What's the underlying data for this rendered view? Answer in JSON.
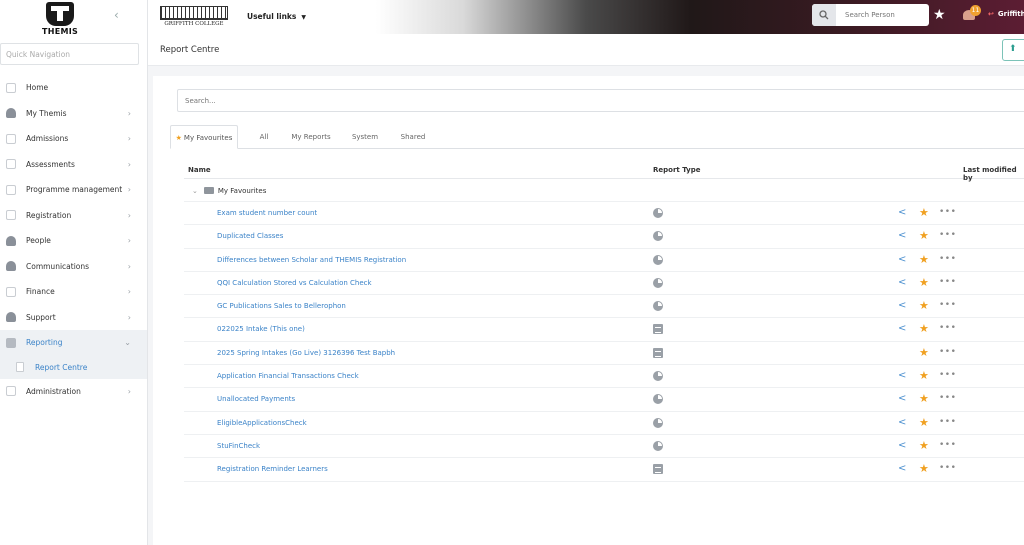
{
  "sidebar": {
    "logo_text": "THEMIS",
    "quick_nav_placeholder": "Quick Navigation",
    "items": [
      {
        "label": "Home",
        "has_chevron": false
      },
      {
        "label": "My Themis",
        "has_chevron": true
      },
      {
        "label": "Admissions",
        "has_chevron": true
      },
      {
        "label": "Assessments",
        "has_chevron": true
      },
      {
        "label": "Programme management",
        "has_chevron": true
      },
      {
        "label": "Registration",
        "has_chevron": true
      },
      {
        "label": "People",
        "has_chevron": true
      },
      {
        "label": "Communications",
        "has_chevron": true
      },
      {
        "label": "Finance",
        "has_chevron": true
      },
      {
        "label": "Support",
        "has_chevron": true
      },
      {
        "label": "Reporting",
        "has_chevron": true,
        "expanded": true
      },
      {
        "label": "Administration",
        "has_chevron": true
      }
    ],
    "reporting_sub": {
      "label": "Report Centre"
    }
  },
  "header": {
    "college_name": "GRIFFITH COLLEGE",
    "useful_links": "Useful links",
    "search_person_placeholder": "Search Person",
    "notification_count": "11",
    "user_name": "Griffith"
  },
  "page": {
    "title": "Report Centre"
  },
  "search": {
    "placeholder": "Search..."
  },
  "tabs": [
    {
      "label": "My Favourites",
      "active": true
    },
    {
      "label": "All"
    },
    {
      "label": "My Reports"
    },
    {
      "label": "System"
    },
    {
      "label": "Shared"
    }
  ],
  "table": {
    "columns": {
      "name": "Name",
      "report_type": "Report Type",
      "last_modified": "Last modified by"
    },
    "folder_label": "My Favourites",
    "rows": [
      {
        "name": "Exam student number count",
        "type": "chart",
        "shared": true
      },
      {
        "name": "Duplicated Classes",
        "type": "chart",
        "shared": true
      },
      {
        "name": "Differences between Scholar and THEMIS Registration",
        "type": "chart",
        "shared": true
      },
      {
        "name": "QQI Calculation Stored vs Calculation Check",
        "type": "chart",
        "shared": true
      },
      {
        "name": "GC Publications Sales to Bellerophon",
        "type": "chart",
        "shared": true
      },
      {
        "name": "022025 Intake (This one)",
        "type": "table",
        "shared": true
      },
      {
        "name": "2025 Spring Intakes (Go Live) 3126396 Test Bapbh",
        "type": "table",
        "shared": false
      },
      {
        "name": "Application Financial Transactions Check",
        "type": "chart",
        "shared": true
      },
      {
        "name": "Unallocated Payments",
        "type": "chart",
        "shared": true
      },
      {
        "name": "EligibleApplicationsCheck",
        "type": "chart",
        "shared": true
      },
      {
        "name": "StuFinCheck",
        "type": "chart",
        "shared": true
      },
      {
        "name": "Registration Reminder Learners",
        "type": "table",
        "shared": true
      }
    ]
  },
  "colors": {
    "accent": "#3b83c8",
    "favourite": "#f0a020",
    "topbar_end": "#5c1d33"
  }
}
